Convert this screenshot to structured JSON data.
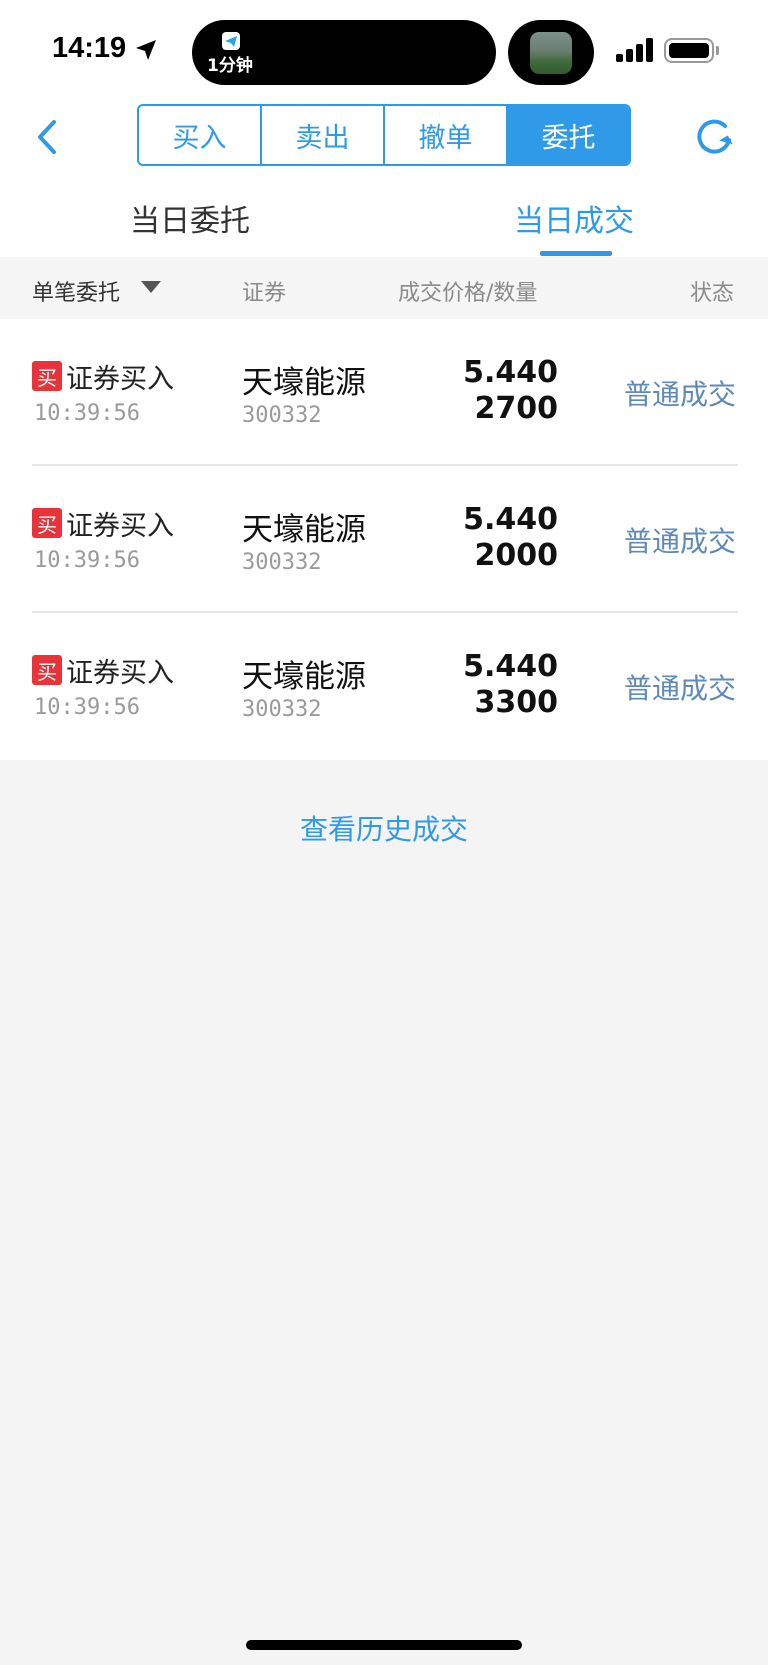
{
  "status_bar": {
    "time": "14:19",
    "island_text": "1分钟"
  },
  "nav": {
    "segments": [
      {
        "label": "买入"
      },
      {
        "label": "卖出"
      },
      {
        "label": "撤单"
      },
      {
        "label": "委托"
      }
    ],
    "active_segment": "委托",
    "accent_color": "#2f9ae8"
  },
  "subtabs": {
    "left": "当日委托",
    "right": "当日成交",
    "active": "当日成交"
  },
  "list_header": {
    "col1": "单笔委托",
    "col2": "证券",
    "col3": "成交价格/数量",
    "col4": "状态"
  },
  "rows": [
    {
      "badge": "买",
      "op": "证券买入",
      "time": "10:39:56",
      "name": "天壕能源",
      "code": "300332",
      "price": "5.440",
      "qty": "2700",
      "status": "普通成交"
    },
    {
      "badge": "买",
      "op": "证券买入",
      "time": "10:39:56",
      "name": "天壕能源",
      "code": "300332",
      "price": "5.440",
      "qty": "2000",
      "status": "普通成交"
    },
    {
      "badge": "买",
      "op": "证券买入",
      "time": "10:39:56",
      "name": "天壕能源",
      "code": "300332",
      "price": "5.440",
      "qty": "3300",
      "status": "普通成交"
    }
  ],
  "history_link": "查看历史成交",
  "icons": {
    "back": "chevron-left-icon",
    "refresh": "refresh-icon",
    "sort": "triangle-down-icon"
  }
}
